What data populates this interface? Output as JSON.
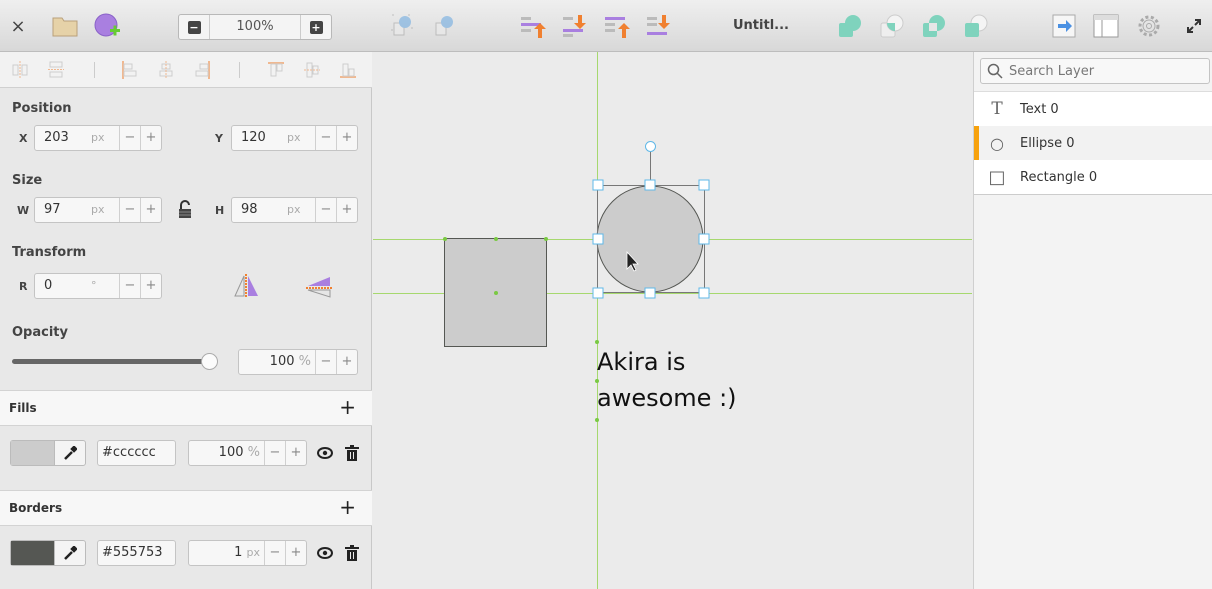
{
  "toolbar": {
    "zoom_value": "100%",
    "zoom_out": "−",
    "zoom_in": "+",
    "title": "Untitl...",
    "close": "×"
  },
  "align_bar": {
    "items": [
      "distribute-horizontal",
      "distribute-vertical",
      "align-left",
      "align-center",
      "align-right",
      "align-top",
      "align-middle",
      "align-bottom"
    ]
  },
  "position": {
    "label": "Position",
    "x_label": "X",
    "x": "203",
    "y_label": "Y",
    "y": "120",
    "unit": "px"
  },
  "size": {
    "label": "Size",
    "w_label": "W",
    "w": "97",
    "h_label": "H",
    "h": "98",
    "unit": "px"
  },
  "transform": {
    "label": "Transform",
    "r_label": "R",
    "r": "0",
    "unit": "°"
  },
  "opacity": {
    "label": "Opacity",
    "value": "100",
    "unit": "%",
    "fraction": 1.0
  },
  "stepper": {
    "minus": "−",
    "plus": "+"
  },
  "fills": {
    "label": "Fills",
    "add": "+",
    "color": "#cccccc",
    "hex": "#cccccc",
    "opacity": "100",
    "unit": "%"
  },
  "borders": {
    "label": "Borders",
    "add": "+",
    "color": "#555753",
    "hex": "#555753",
    "width": "1",
    "unit": "px"
  },
  "canvas": {
    "text_line1": "Akira is",
    "text_line2": "awesome :)",
    "rect_fill": "#cccccc",
    "ellipse_fill": "#cccccc",
    "guide_color": "#a6d86e",
    "handle_color": "#5fb8e8"
  },
  "layers": {
    "search_placeholder": "Search Layer",
    "items": [
      {
        "icon": "T",
        "label": "Text 0"
      },
      {
        "icon": "○",
        "label": "Ellipse 0",
        "selected": true
      },
      {
        "icon": "□",
        "label": "Rectangle 0"
      }
    ]
  },
  "accent": "#f7a20d"
}
